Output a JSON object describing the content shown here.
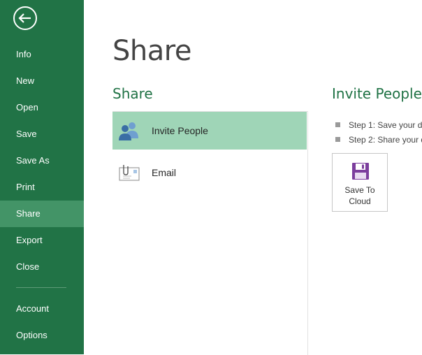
{
  "sidebar": {
    "back_icon": "back-arrow-icon",
    "items": [
      {
        "label": "Info"
      },
      {
        "label": "New"
      },
      {
        "label": "Open"
      },
      {
        "label": "Save"
      },
      {
        "label": "Save As"
      },
      {
        "label": "Print"
      },
      {
        "label": "Share",
        "active": true
      },
      {
        "label": "Export"
      },
      {
        "label": "Close"
      },
      {
        "label": "Account"
      },
      {
        "label": "Options"
      }
    ]
  },
  "main": {
    "title": "Share",
    "section_title": "Share",
    "options": [
      {
        "label": "Invite People",
        "icon": "people-icon",
        "selected": true
      },
      {
        "label": "Email",
        "icon": "email-icon",
        "selected": false
      }
    ]
  },
  "panel": {
    "title": "Invite People",
    "steps": [
      "Step 1: Save your dc",
      "Step 2: Share your d"
    ],
    "save_button_label": "Save To Cloud",
    "save_button_icon": "floppy-disk-icon"
  },
  "colors": {
    "sidebar_bg": "#217346",
    "sidebar_active": "#439467",
    "accent": "#217346",
    "selected_option": "#9fd5b7",
    "save_icon": "#7c3e9d"
  }
}
